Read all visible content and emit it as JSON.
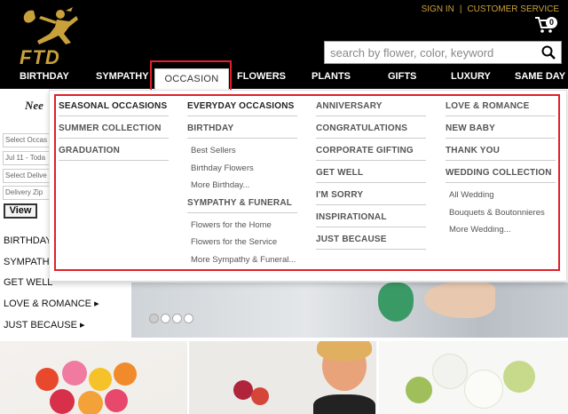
{
  "brand": {
    "logo_text": "FTD",
    "accent_color": "#c9a13b",
    "highlight_color": "#e0202a"
  },
  "top_links": [
    "SIGN IN",
    "|",
    "CUSTOMER SERVICE"
  ],
  "cart": {
    "icon": "cart-icon",
    "count": "0"
  },
  "search": {
    "placeholder": "search by flower, color, keyword",
    "icon": "search-icon"
  },
  "nav": {
    "items": [
      "BIRTHDAY",
      "SYMPATHY",
      "OCCASION",
      "FLOWERS",
      "PLANTS",
      "GIFTS",
      "LUXURY",
      "SAME DAY"
    ],
    "active": "OCCASION"
  },
  "left": {
    "heading": "Nee",
    "fields": [
      "Select Occas",
      "Jul 11 - Toda",
      "Select Delive",
      "Delivery Zip"
    ],
    "view_button": "View",
    "links": [
      "BIRTHDAY",
      "SYMPATHY",
      "GET WELL",
      "LOVE & ROMANCE ▸",
      "JUST BECAUSE ▸"
    ]
  },
  "dropdown": {
    "col1": {
      "sections": [
        "SEASONAL OCCASIONS",
        "SUMMER COLLECTION",
        "GRADUATION"
      ]
    },
    "col2": {
      "heading": "EVERYDAY OCCASIONS",
      "birthday": "BIRTHDAY",
      "birthday_items": [
        "Best Sellers",
        "Birthday Flowers",
        "More Birthday..."
      ],
      "sympathy": "SYMPATHY & FUNERAL",
      "sympathy_items": [
        "Flowers for the Home",
        "Flowers for the Service",
        "More Sympathy & Funeral..."
      ]
    },
    "col3": {
      "sections": [
        "ANNIVERSARY",
        "CONGRATULATIONS",
        "CORPORATE GIFTING",
        "GET WELL",
        "I'M SORRY",
        "INSPIRATIONAL",
        "JUST BECAUSE"
      ]
    },
    "col4": {
      "sections": [
        "LOVE & ROMANCE",
        "NEW BABY",
        "THANK YOU"
      ],
      "wedding": "WEDDING COLLECTION",
      "wedding_items": [
        "All Wedding",
        "Bouquets & Boutonnieres",
        "More Wedding..."
      ]
    }
  }
}
